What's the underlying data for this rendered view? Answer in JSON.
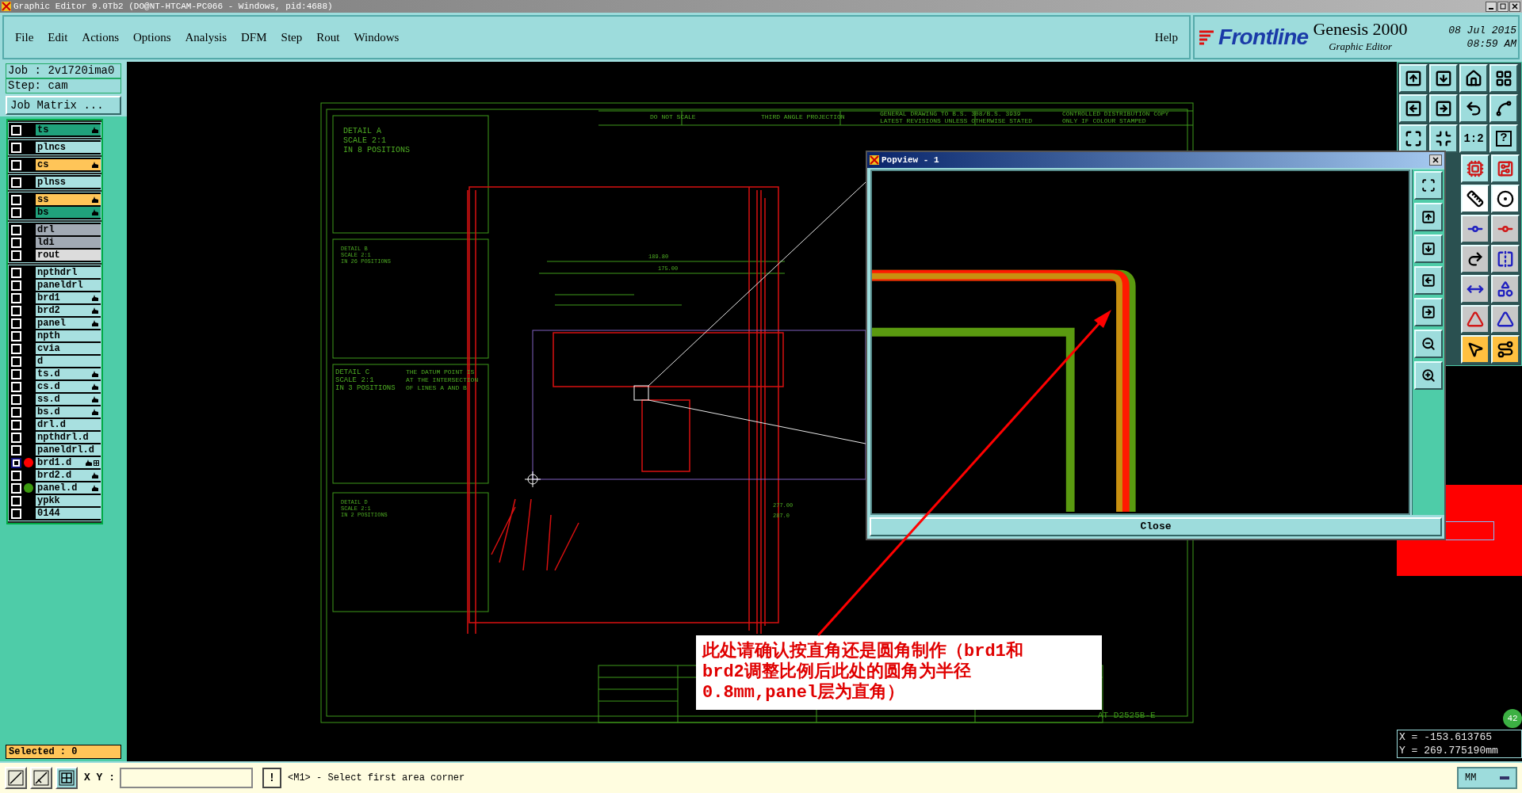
{
  "window": {
    "title": "Graphic Editor 9.0Tb2 (DO@NT-HTCAM-PC066 - Windows, pid:4688)"
  },
  "menu": [
    "File",
    "Edit",
    "Actions",
    "Options",
    "Analysis",
    "DFM",
    "Step",
    "Rout",
    "Windows"
  ],
  "help": "Help",
  "brand": {
    "logo": "Frontline",
    "product": "Genesis 2000",
    "subtitle": "Graphic Editor",
    "date": "08 Jul 2015",
    "time": "08:59 AM"
  },
  "job": "Job : 2v1720ima0",
  "step": "Step: cam",
  "job_matrix": "Job Matrix ...",
  "layer_groups": [
    {
      "layers": [
        {
          "name": "ts",
          "color": "#20a27c",
          "affected": true,
          "selected": false
        }
      ]
    },
    {
      "layers": [
        {
          "name": "plncs",
          "color": "#a8e0e0",
          "affected": false,
          "selected": false
        }
      ]
    },
    {
      "layers": [
        {
          "name": "cs",
          "color": "#ffc558",
          "affected": true,
          "selected": false
        }
      ]
    },
    {
      "layers": [
        {
          "name": "plnss",
          "color": "#a8e0e0",
          "affected": false,
          "selected": false
        }
      ]
    },
    {
      "layers": [
        {
          "name": "ss",
          "color": "#ffc558",
          "affected": true,
          "selected": false
        },
        {
          "name": "bs",
          "color": "#20a27c",
          "affected": true,
          "selected": false
        }
      ]
    },
    {
      "layers": [
        {
          "name": "drl",
          "color": "#a2aab4",
          "affected": false,
          "selected": false
        },
        {
          "name": "ldi",
          "color": "#a2aab4",
          "affected": false,
          "selected": false
        },
        {
          "name": "rout",
          "color": "#dcdcdc",
          "affected": false,
          "selected": false
        }
      ]
    },
    {
      "layers": [
        {
          "name": "npthdrl",
          "color": "#a8e0e0",
          "affected": false,
          "selected": false
        },
        {
          "name": "paneldrl",
          "color": "#a8e0e0",
          "affected": false,
          "selected": false
        },
        {
          "name": "brd1",
          "color": "#a8e0e0",
          "affected": true,
          "selected": false
        },
        {
          "name": "brd2",
          "color": "#a8e0e0",
          "affected": true,
          "selected": false
        },
        {
          "name": "panel",
          "color": "#a8e0e0",
          "affected": true,
          "selected": false
        },
        {
          "name": "npth",
          "color": "#a8e0e0",
          "affected": false,
          "selected": false
        },
        {
          "name": "cvia",
          "color": "#a8e0e0",
          "affected": false,
          "selected": false
        },
        {
          "name": "d",
          "color": "#a8e0e0",
          "affected": false,
          "selected": false
        },
        {
          "name": "ts.d",
          "color": "#a8e0e0",
          "affected": true,
          "selected": false
        },
        {
          "name": "cs.d",
          "color": "#a8e0e0",
          "affected": true,
          "selected": false
        },
        {
          "name": "ss.d",
          "color": "#a8e0e0",
          "affected": true,
          "selected": false
        },
        {
          "name": "bs.d",
          "color": "#a8e0e0",
          "affected": true,
          "selected": false
        },
        {
          "name": "drl.d",
          "color": "#a8e0e0",
          "affected": false,
          "selected": false
        },
        {
          "name": "npthdrl.d",
          "color": "#a8e0e0",
          "affected": false,
          "selected": false
        },
        {
          "name": "paneldrl.d",
          "color": "#a8e0e0",
          "affected": false,
          "selected": false
        },
        {
          "name": "brd1.d",
          "color": "#a8e0e0",
          "affected": true,
          "selected": true,
          "shown": {
            "color": "#ff0000"
          },
          "flag": true
        },
        {
          "name": "brd2.d",
          "color": "#a8e0e0",
          "affected": true,
          "selected": false
        },
        {
          "name": "panel.d",
          "color": "#a8e0e0",
          "affected": true,
          "selected": false,
          "shown": {
            "color": "#3c9a10"
          }
        },
        {
          "name": "ypkk",
          "color": "#a8e0e0",
          "affected": false,
          "selected": false
        },
        {
          "name": "0144",
          "color": "#a8e0e0",
          "affected": false,
          "selected": false
        }
      ]
    }
  ],
  "selected_count": "Selected : 0",
  "drawing_texts": [
    "DO NOT SCALE",
    "THIRD ANGLE PROJECTION",
    "GENERAL DRAWING TO B.S. 308/B.S. 3939",
    "LATEST REVISIONS UNLESS OTHERWISE STATED",
    "CONTROLLED DISTRIBUTION COPY",
    "ONLY IF COLOUR STAMPED",
    "DETAIL A",
    "SCALE 2:1",
    "IN 8 POSITIONS",
    "DETAIL B",
    "SCALE 2:1",
    "IN 26 POSITIONS",
    "DETAIL C",
    "SCALE 2:1",
    "IN 3 POSITIONS",
    "THE DATUM POINT IS",
    "AT THE INTERSECTION",
    "OF LINES A AND B",
    "DETAIL D",
    "SCALE 2:1",
    "IN 2 POSITIONS",
    "189.80",
    "175.00",
    "277.00",
    "287.0",
    "AT D2525B-E"
  ],
  "popview": {
    "title": "Popview - 1",
    "close": "Close"
  },
  "annotation": "此处请确认按直角还是圆角制作（brd1和brd2调整比例后此处的圆角为半径0.8mm,panel层为直角）",
  "toolbar_labels": [
    "1:2",
    "?"
  ],
  "badge": "42",
  "coords": {
    "x": "X = -153.613765",
    "y": "Y = 269.775190mm"
  },
  "command": {
    "label": "X Y :",
    "bang": "!",
    "message": "<M1> - Select first area corner",
    "units": "MM"
  }
}
